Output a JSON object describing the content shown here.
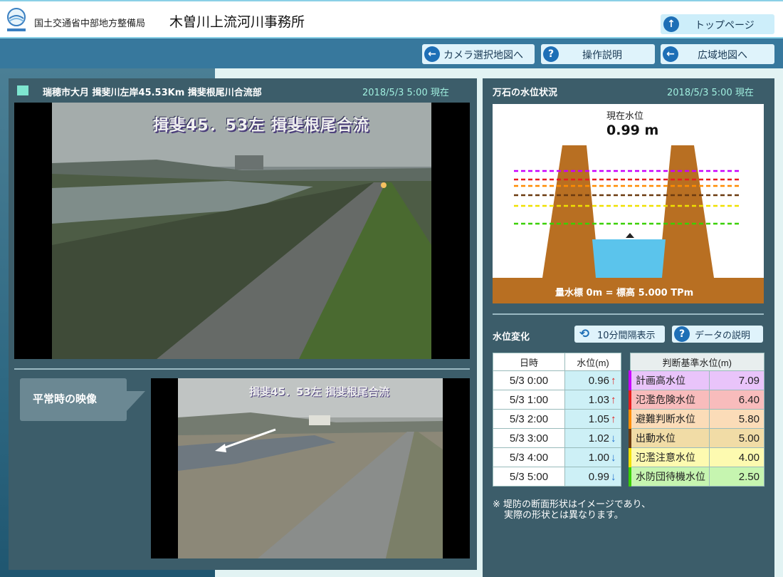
{
  "header": {
    "agency": "国土交通省中部地方整備局",
    "office": "木曽川上流河川事務所",
    "top_button": "トップページ"
  },
  "nav": {
    "camera_map": "カメラ選択地図へ",
    "operation": "操作説明",
    "wide_map": "広域地図へ"
  },
  "camera": {
    "location": "瑞穂市大月 揖斐川左岸45.53Km 揖斐根尾川合流部",
    "timestamp": "2018/5/3 5:00 現在",
    "overlay_text": "揖斐45．53左 揖斐根尾合流"
  },
  "normal_view": {
    "label": "平常時の映像",
    "overlay_text": "揖斐45．53左 揖斐根尾合流"
  },
  "water": {
    "title": "万石の水位状況",
    "timestamp": "2018/5/3 5:00 現在",
    "current_label": "現在水位",
    "current_value": "0.99 m",
    "baseline": "量水標 0m = 標高 5.000 TPm",
    "level_lines": [
      {
        "color": "#c800ff"
      },
      {
        "color": "#e81e1e"
      },
      {
        "color": "#ff8c00"
      },
      {
        "color": "#6b3a10"
      },
      {
        "color": "#f0e000"
      },
      {
        "color": "#3ad000"
      }
    ]
  },
  "history": {
    "section_label": "水位変化",
    "interval_button": "10分間隔表示",
    "data_button": "データの説明",
    "col_time": "日時",
    "col_level": "水位(m)",
    "rows": [
      {
        "time": "5/3 0:00",
        "level": "0.96",
        "trend": "↑",
        "dir": "up"
      },
      {
        "time": "5/3 1:00",
        "level": "1.03",
        "trend": "↑",
        "dir": "up"
      },
      {
        "time": "5/3 2:00",
        "level": "1.05",
        "trend": "↑",
        "dir": "up"
      },
      {
        "time": "5/3 3:00",
        "level": "1.02",
        "trend": "↓",
        "dir": "down"
      },
      {
        "time": "5/3 4:00",
        "level": "1.00",
        "trend": "↓",
        "dir": "down"
      },
      {
        "time": "5/3 5:00",
        "level": "0.99",
        "trend": "↓",
        "dir": "down"
      }
    ]
  },
  "thresholds": {
    "header": "判断基準水位(m)",
    "rows": [
      {
        "name": "計画高水位",
        "value": "7.09",
        "color": "#c800ff",
        "bg": "#e9c4fa"
      },
      {
        "name": "氾濫危険水位",
        "value": "6.40",
        "color": "#e81e1e",
        "bg": "#f8bcbc"
      },
      {
        "name": "避難判断水位",
        "value": "5.80",
        "color": "#ff8c00",
        "bg": "#fbdcb8"
      },
      {
        "name": "出動水位",
        "value": "5.00",
        "color": "#6b3a10",
        "bg": "#f1dca6"
      },
      {
        "name": "氾濫注意水位",
        "value": "4.00",
        "color": "#f0e000",
        "bg": "#fdfab0"
      },
      {
        "name": "水防団待機水位",
        "value": "2.50",
        "color": "#3ad000",
        "bg": "#c6f5b0"
      }
    ]
  },
  "note": {
    "line1": "※ 堤防の断面形状はイメージであり、",
    "line2": "実際の形状とは異なります。"
  }
}
